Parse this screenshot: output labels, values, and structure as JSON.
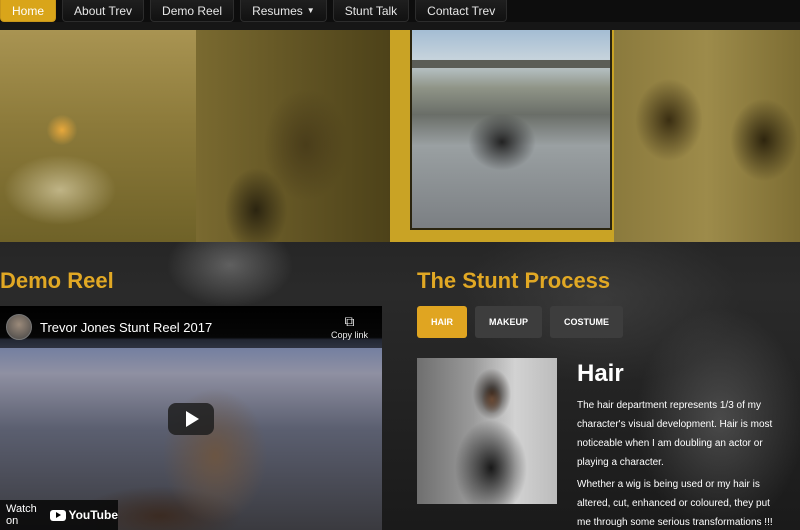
{
  "nav": {
    "items": [
      {
        "label": "Home"
      },
      {
        "label": "About Trev"
      },
      {
        "label": "Demo Reel"
      },
      {
        "label": "Resumes"
      },
      {
        "label": "Stunt Talk"
      },
      {
        "label": "Contact Trev"
      }
    ]
  },
  "demo_reel": {
    "heading": "Demo Reel",
    "video": {
      "title": "Trevor Jones Stunt Reel 2017",
      "copy_link": "Copy link",
      "watch_on": "Watch on",
      "youtube": "YouTube"
    }
  },
  "stunt_process": {
    "heading": "The Stunt Process",
    "tabs": [
      {
        "label": "HAIR"
      },
      {
        "label": "MAKEUP"
      },
      {
        "label": "COSTUME"
      }
    ],
    "content": {
      "title": "Hair",
      "paragraphs": [
        "The hair department represents 1/3 of my character's visual development. Hair is most noticeable when I am doubling an actor or playing a character.",
        "Whether a wig is being used or my hair is altered, cut, enhanced or coloured, they put me through some serious transformations !!!"
      ]
    }
  },
  "colors": {
    "accent": "#e1a824",
    "nav_active": "#d9a51a",
    "tab_inactive": "#3d3d3d"
  },
  "icons": [
    "chevron-down-icon",
    "copy-icon",
    "play-icon",
    "youtube-logo-icon"
  ]
}
